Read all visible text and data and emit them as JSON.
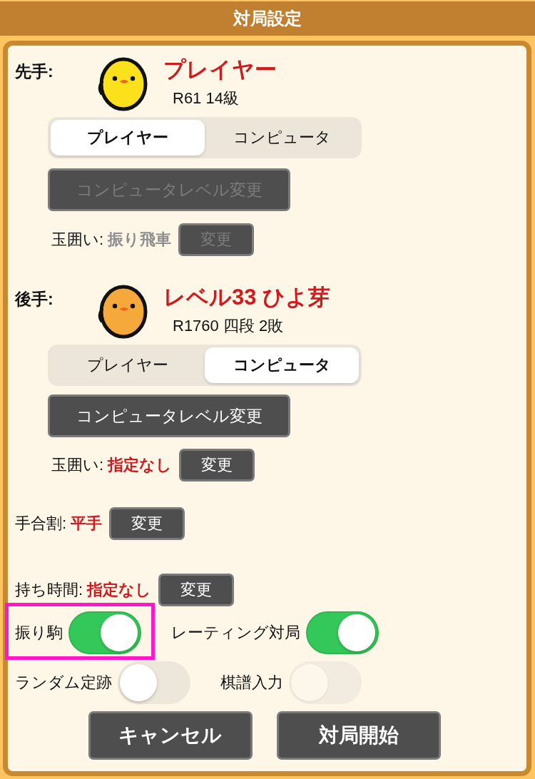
{
  "header": {
    "title": "対局設定"
  },
  "players": [
    {
      "side_label": "先手:",
      "color": "#fbe01c",
      "name": "プレイヤー",
      "rating": "R61 14級",
      "modes": [
        {
          "label": "プレイヤー",
          "selected": true
        },
        {
          "label": "コンピュータ",
          "selected": false
        }
      ],
      "level_button": {
        "label": "コンピュータレベル変更",
        "disabled": true
      },
      "castle": {
        "label": "玉囲い:",
        "value": "振り飛車",
        "button": "変更",
        "disabled": true
      }
    },
    {
      "side_label": "後手:",
      "color": "#f5a93b",
      "name": "レベル33 ひよ芽",
      "rating": "R1760 四段 2敗",
      "modes": [
        {
          "label": "プレイヤー",
          "selected": false
        },
        {
          "label": "コンピュータ",
          "selected": true
        }
      ],
      "level_button": {
        "label": "コンピュータレベル変更",
        "disabled": false
      },
      "castle": {
        "label": "玉囲い:",
        "value": "指定なし",
        "button": "変更",
        "disabled": false
      }
    }
  ],
  "settings": [
    {
      "label": "手合割:",
      "value": "平手",
      "button": "変更"
    },
    {
      "label": "持ち時間:",
      "value": "指定なし",
      "button": "変更"
    }
  ],
  "toggle_rows": [
    [
      {
        "label": "振り駒",
        "on": true,
        "disabled": false,
        "highlighted": true
      },
      {
        "label": "レーティング対局",
        "on": true,
        "disabled": false,
        "highlighted": false
      }
    ],
    [
      {
        "label": "ランダム定跡",
        "on": false,
        "disabled": false,
        "highlighted": false
      },
      {
        "label": "棋譜入力",
        "on": false,
        "disabled": true,
        "highlighted": false
      }
    ]
  ],
  "actions": [
    "キャンセル",
    "対局開始"
  ]
}
